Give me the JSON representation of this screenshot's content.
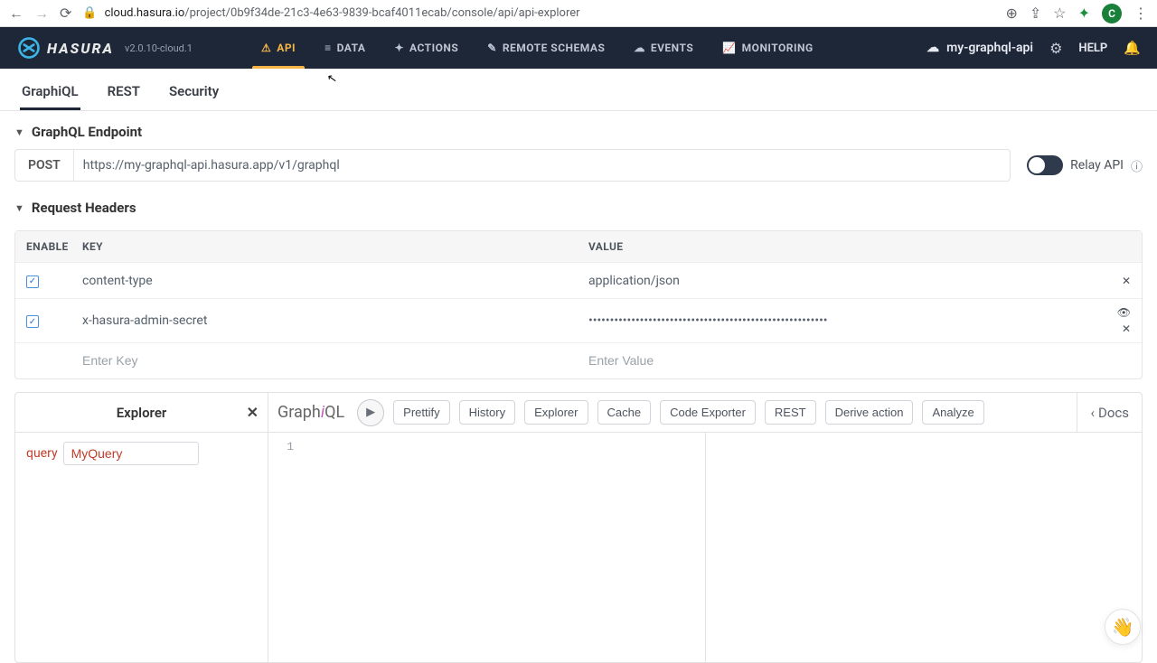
{
  "browser": {
    "url_host": "cloud.hasura.io",
    "url_path": "/project/0b9f34de-21c3-4e63-9839-bcaf4011ecab/console/api/api-explorer",
    "avatar_initial": "C"
  },
  "brand": {
    "name": "HASURA",
    "version": "v2.0.10-cloud.1"
  },
  "topnav": {
    "items": [
      {
        "label": "API",
        "icon": "⚠"
      },
      {
        "label": "DATA",
        "icon": "≡"
      },
      {
        "label": "ACTIONS",
        "icon": "✦"
      },
      {
        "label": "REMOTE SCHEMAS",
        "icon": "✎"
      },
      {
        "label": "EVENTS",
        "icon": "☁"
      },
      {
        "label": "MONITORING",
        "icon": "📈"
      }
    ],
    "project_name": "my-graphql-api",
    "help": "HELP"
  },
  "subtabs": [
    "GraphiQL",
    "REST",
    "Security"
  ],
  "endpoint": {
    "section_title": "GraphQL Endpoint",
    "method": "POST",
    "url": "https://my-graphql-api.hasura.app/v1/graphql",
    "relay_label": "Relay API"
  },
  "headers": {
    "section_title": "Request Headers",
    "cols": {
      "enable": "ENABLE",
      "key": "KEY",
      "value": "VALUE"
    },
    "rows": [
      {
        "enabled": true,
        "key": "content-type",
        "value": "application/json",
        "secret": false
      },
      {
        "enabled": true,
        "key": "x-hasura-admin-secret",
        "value": "••••••••••••••••••••••••••••••••••••••••••••••••••••••••",
        "secret": true
      }
    ],
    "key_placeholder": "Enter Key",
    "value_placeholder": "Enter Value"
  },
  "explorer": {
    "title": "Explorer",
    "query_kw": "query",
    "query_name": "MyQuery"
  },
  "graphiql": {
    "title_a": "Graph",
    "title_b": "i",
    "title_c": "QL",
    "buttons": [
      "Prettify",
      "History",
      "Explorer",
      "Cache",
      "Code Exporter",
      "REST",
      "Derive action",
      "Analyze"
    ],
    "docs": "Docs",
    "line1": "1"
  }
}
